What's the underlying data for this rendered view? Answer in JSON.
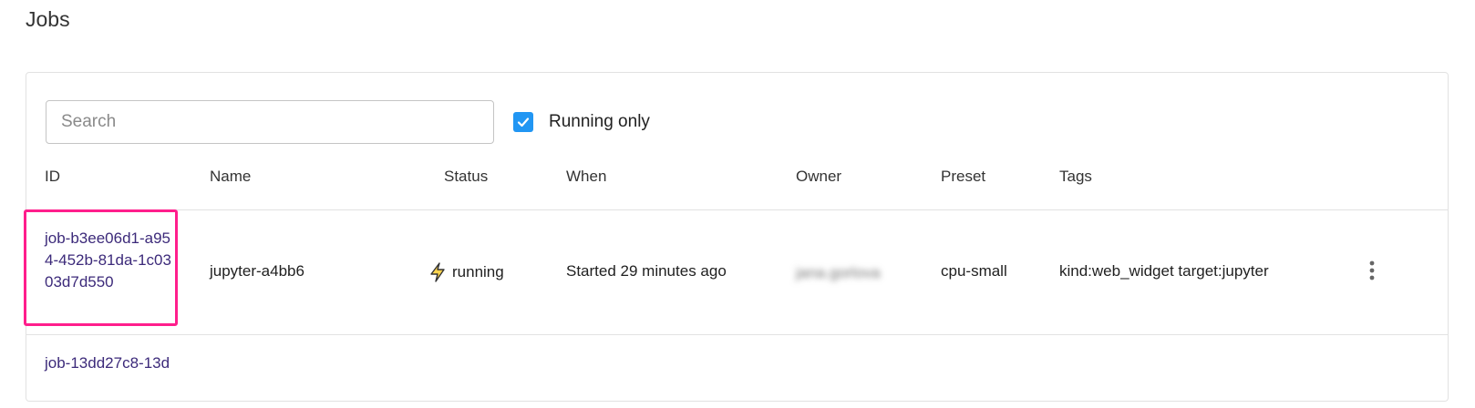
{
  "page": {
    "title": "Jobs"
  },
  "toolbar": {
    "search_placeholder": "Search",
    "search_value": "",
    "running_only_label": "Running only",
    "running_only_checked": true
  },
  "table": {
    "columns": [
      "ID",
      "Name",
      "Status",
      "When",
      "Owner",
      "Preset",
      "Tags"
    ],
    "rows": [
      {
        "id": "job-b3ee06d1-a954-452b-81da-1c0303d7d550",
        "name": "jupyter-a4bb6",
        "status": "running",
        "status_icon": "lightning-icon",
        "when": "Started 29 minutes ago",
        "owner": "jana.gorlova",
        "preset": "cpu-small",
        "tags": "kind:web_widget target:jupyter"
      },
      {
        "id": "job-13dd27c8-13d"
      }
    ]
  },
  "colors": {
    "accent": "#2196f3",
    "link": "#3c2a7a",
    "highlight": "#ff1e8c",
    "status_icon": "#f5b400"
  }
}
